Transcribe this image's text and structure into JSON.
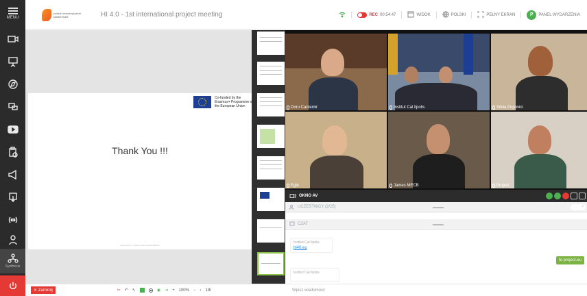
{
  "sidebar": {
    "menu_label": "MENU",
    "active_label": "Synthesis",
    "items": [
      "camera-icon",
      "presentation-icon",
      "compass-icon",
      "desktop-icon",
      "video-play-icon",
      "clipboard-icon",
      "megaphone-icon",
      "touch-icon",
      "broadcast-icon",
      "users-network-icon"
    ]
  },
  "header": {
    "logo_text": "polskie stowarzyszenie akademickie",
    "title": "HI 4.0 - 1st international project meeting",
    "rec_label": "REC",
    "rec_time": "00:54:47",
    "view_label": "WIDOK",
    "lang_label": "POLSKI",
    "fullscreen_label": "PEŁNY EKRAN",
    "avatar_letter": "P",
    "events_label": "PANEL WYDARZENIA"
  },
  "slide": {
    "eu_text": "Co-funded by the Erasmus+ Programme of the European Union",
    "main_text": "Thank You !!!",
    "footer_text": "Agreement n° 2020-1-ES01-KA202-082187"
  },
  "participants_video": [
    {
      "name": "Doru Cantemir"
    },
    {
      "name": "Institut Cal Ilpolis"
    },
    {
      "name": "Silvia Popovici"
    },
    {
      "name": "Egle"
    },
    {
      "name": "James MECB"
    },
    {
      "name": "Project"
    }
  ],
  "av_panel": {
    "title": "OKNO AV"
  },
  "participants_panel": {
    "title": "UCZESTNICY (2/25)"
  },
  "chat": {
    "title": "CZAT",
    "messages": [
      {
        "author": "Institut Cal Ilpolis",
        "text": "hi40.eu"
      },
      {
        "author": "Institut Cal Ilpolis",
        "text": ""
      }
    ],
    "own_message": "hi-project.eu",
    "input_placeholder": "Wpisz wiadomość"
  },
  "toolbar": {
    "close_label": "Zamknij",
    "zoom": "100%",
    "page": "19/"
  },
  "colors": {
    "accent_green": "#4caf50",
    "rec_red": "#e53935",
    "link_blue": "#1e88e5"
  }
}
